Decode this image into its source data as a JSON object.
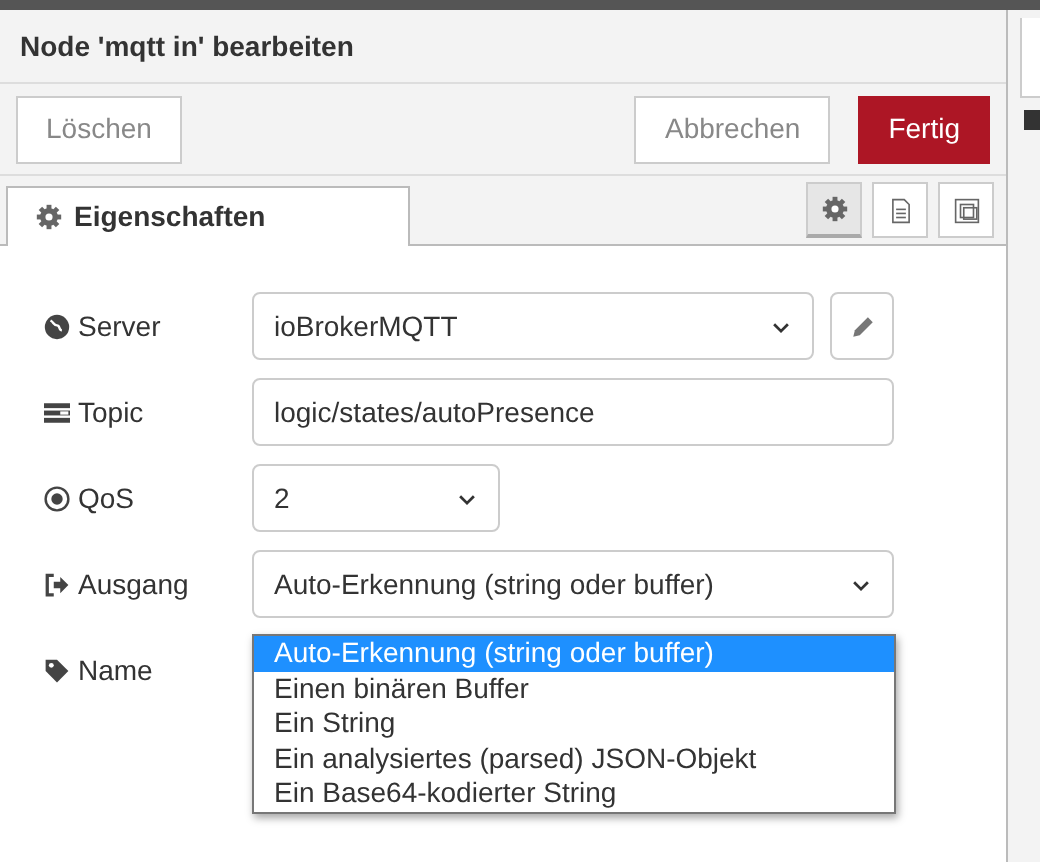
{
  "dialog": {
    "title": "Node 'mqtt in' bearbeiten"
  },
  "buttons": [
    {
      "label": "Löschen",
      "kind": "plain"
    },
    {
      "label": "Abbrechen",
      "kind": "plain"
    },
    {
      "label": "Fertig",
      "kind": "primary"
    }
  ],
  "tabs": [
    {
      "label": "Eigenschaften",
      "selected": true
    }
  ],
  "tab_tools": [
    {
      "kind": "gear",
      "selected": true
    },
    {
      "kind": "document",
      "selected": false
    },
    {
      "kind": "frame",
      "selected": false
    }
  ],
  "fields": [
    {
      "label": "Server",
      "kind": "select",
      "value": "ioBrokerMQTT"
    },
    {
      "label": "Topic",
      "kind": "input",
      "value": "logic/states/autoPresence"
    },
    {
      "label": "QoS",
      "kind": "select",
      "value": "2"
    },
    {
      "label": "Ausgang",
      "kind": "select",
      "value": "Auto-Erkennung (string oder buffer)"
    },
    {
      "label": "Name",
      "kind": "hidden"
    }
  ],
  "dropdown": {
    "options": [
      {
        "label": "Auto-Erkennung (string oder buffer)",
        "selected": true
      },
      {
        "label": "Einen binären Buffer",
        "selected": false
      },
      {
        "label": "Ein String",
        "selected": false
      },
      {
        "label": "Ein analysiertes (parsed) JSON-Objekt",
        "selected": false
      },
      {
        "label": "Ein Base64-kodierter String",
        "selected": false
      }
    ]
  }
}
